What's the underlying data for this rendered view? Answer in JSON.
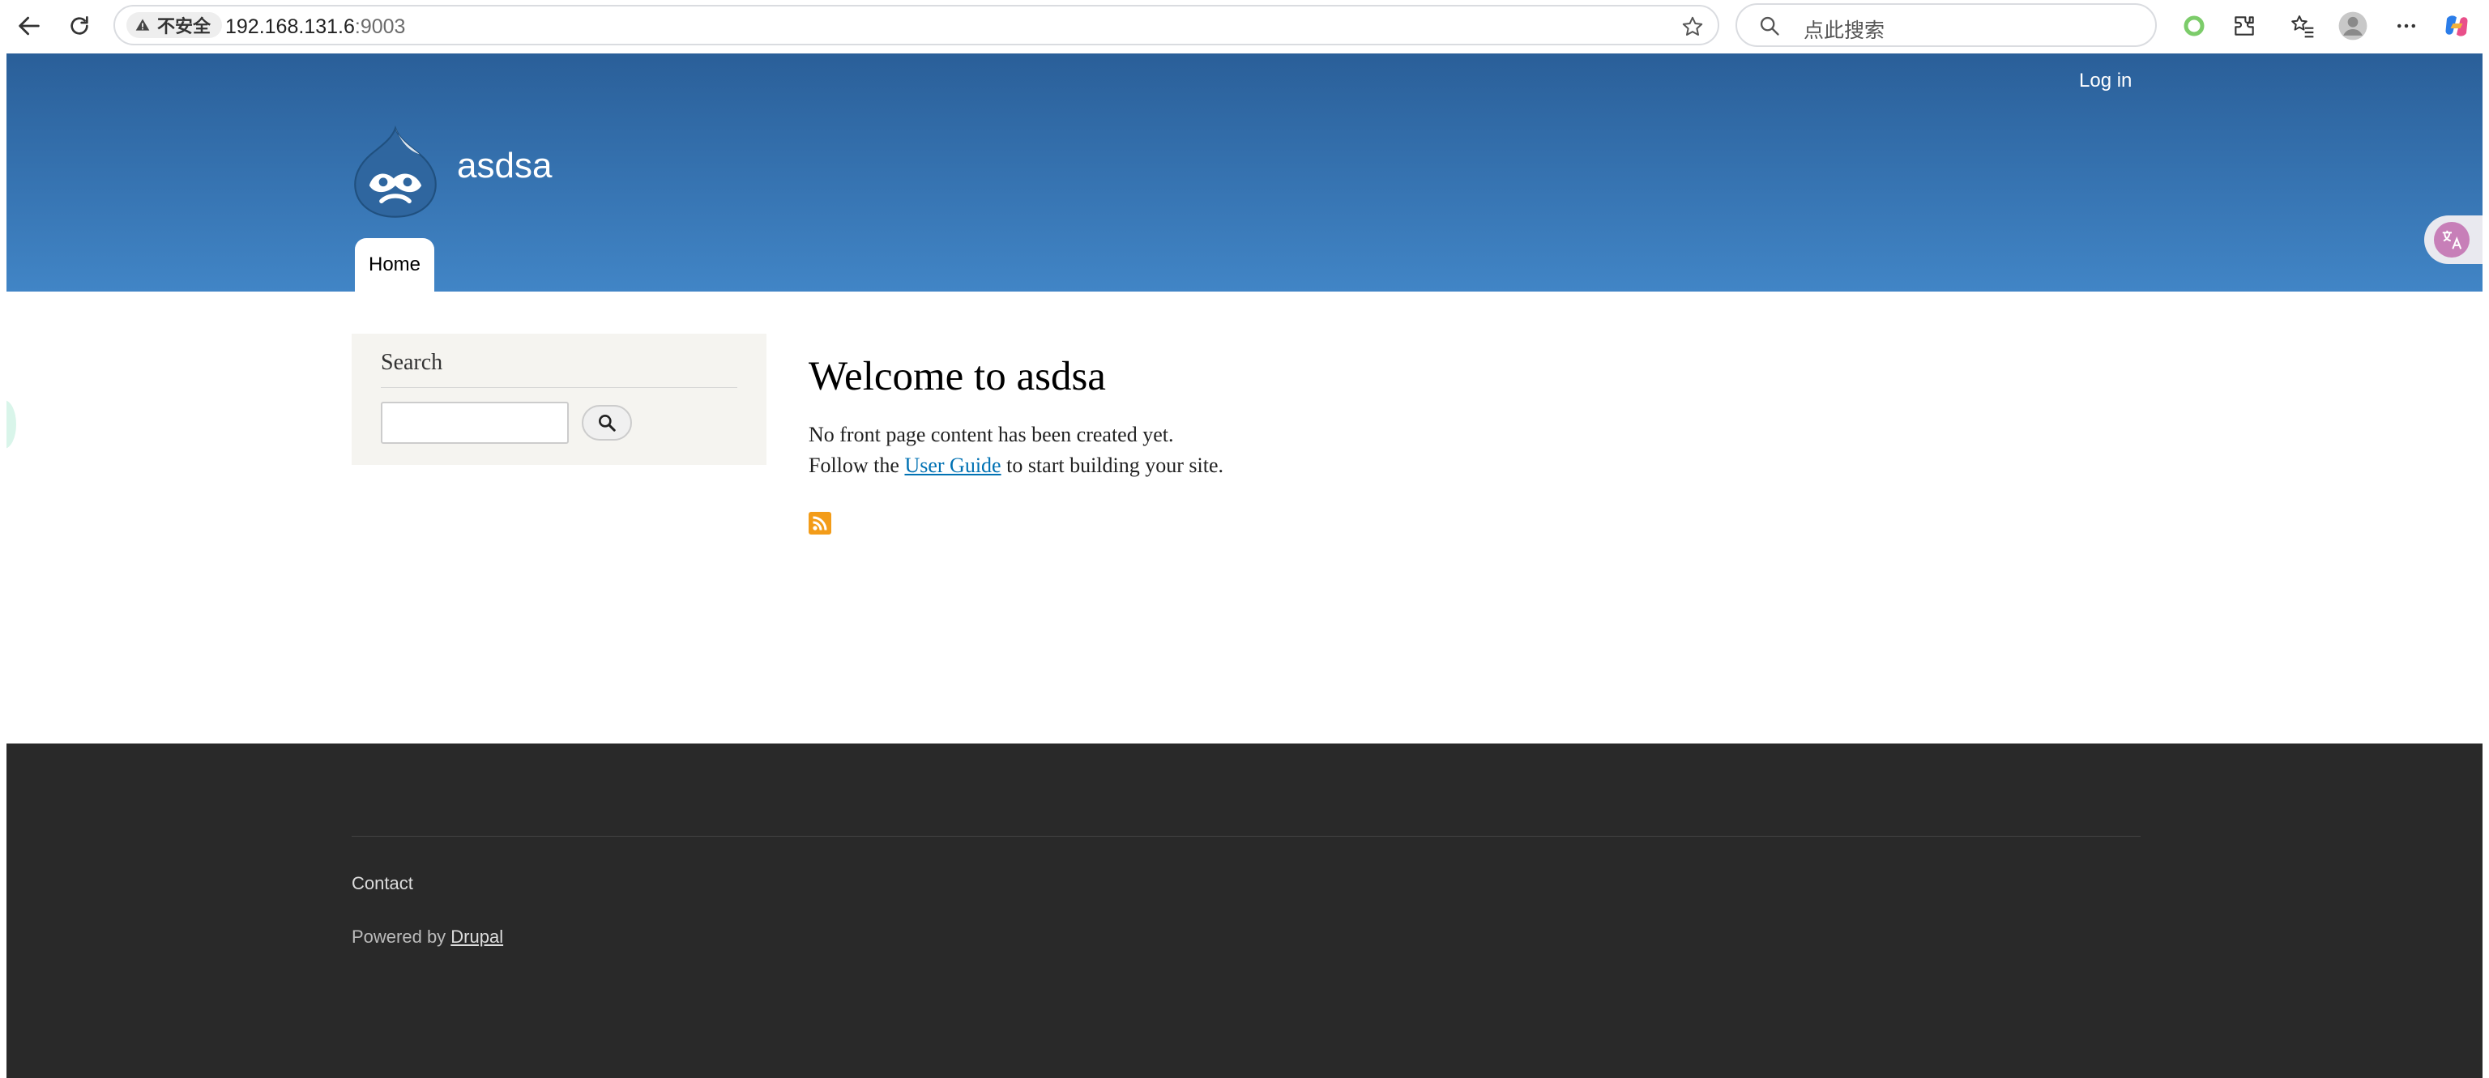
{
  "browser": {
    "security_label": "不安全",
    "url_host": "192.168.131.6",
    "url_port": ":9003",
    "search_placeholder": "点此搜索"
  },
  "header": {
    "login_label": "Log in",
    "site_name": "asdsa",
    "nav_home": "Home",
    "colors": {
      "gradient_top": "#2a5f99",
      "gradient_bottom": "#4185c6"
    }
  },
  "sidebar": {
    "search_title": "Search",
    "search_input_value": ""
  },
  "main": {
    "title": "Welcome to asdsa",
    "line1": "No front page content has been created yet.",
    "line2_prefix": "Follow the ",
    "line2_link": "User Guide",
    "line2_suffix": " to start building your site."
  },
  "footer": {
    "contact_label": "Contact",
    "powered_prefix": "Powered by ",
    "powered_link": "Drupal"
  },
  "icons": [
    "back-icon",
    "reload-icon",
    "warning-icon",
    "star-icon",
    "search-icon",
    "extension-icon",
    "favorites-icon",
    "profile-icon",
    "more-icon",
    "copilot-icon",
    "drupal-logo",
    "translate-icon",
    "rss-icon"
  ]
}
